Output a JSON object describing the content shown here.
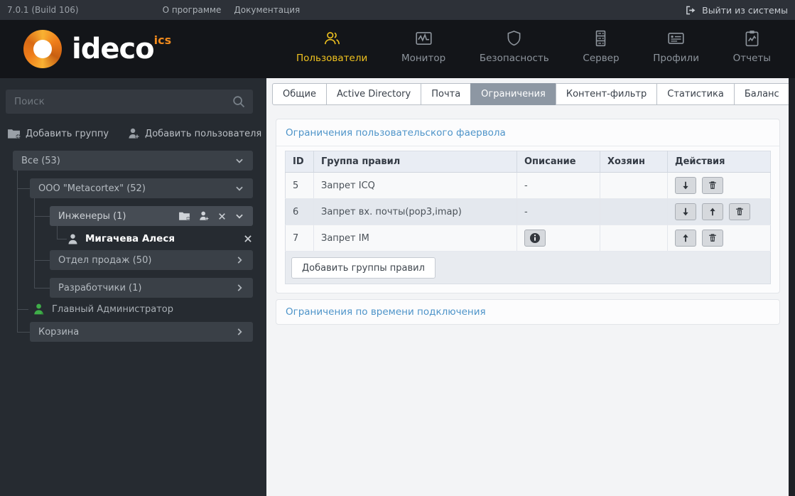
{
  "topbar": {
    "version": "7.0.1 (Build 106)",
    "about": "О программе",
    "docs": "Документация",
    "logout": "Выйти из системы"
  },
  "logo": {
    "brand": "ideco",
    "suffix": "ics"
  },
  "nav": {
    "items": [
      {
        "label": "Пользователи",
        "icon": "users-icon",
        "active": true
      },
      {
        "label": "Монитор",
        "icon": "monitor-icon",
        "active": false
      },
      {
        "label": "Безопасность",
        "icon": "shield-icon",
        "active": false
      },
      {
        "label": "Сервер",
        "icon": "server-icon",
        "active": false
      },
      {
        "label": "Профили",
        "icon": "id-card-icon",
        "active": false
      },
      {
        "label": "Отчеты",
        "icon": "report-icon",
        "active": false
      }
    ]
  },
  "sidebar": {
    "search_placeholder": "Поиск",
    "add_group": "Добавить группу",
    "add_user": "Добавить пользователя",
    "tree": [
      {
        "label": "Все (53)",
        "type": "group",
        "chevron": "down"
      },
      {
        "label": "ООО \"Metacortex\" (52)",
        "type": "group",
        "chevron": "down"
      },
      {
        "label": "Инженеры (1)",
        "type": "group",
        "chevron": "down",
        "selected": true,
        "actions": [
          "add-group",
          "add-user",
          "delete"
        ]
      },
      {
        "label": "Мигачева Алеся",
        "type": "user",
        "actions": [
          "delete"
        ]
      },
      {
        "label": "Отдел продаж (50)",
        "type": "group",
        "chevron": "right"
      },
      {
        "label": "Разработчики (1)",
        "type": "group",
        "chevron": "right"
      },
      {
        "label": "Главный Администратор",
        "type": "admin-user"
      },
      {
        "label": "Корзина",
        "type": "group",
        "chevron": "right"
      }
    ]
  },
  "main": {
    "tabs": [
      {
        "label": "Общие",
        "active": false
      },
      {
        "label": "Active Directory",
        "active": false
      },
      {
        "label": "Почта",
        "active": false
      },
      {
        "label": "Ограничения",
        "active": true
      },
      {
        "label": "Контент-фильтр",
        "active": false
      },
      {
        "label": "Статистика",
        "active": false
      },
      {
        "label": "Баланс",
        "active": false
      }
    ],
    "firewall_section": {
      "title": "Ограничения пользовательского фаервола",
      "table": {
        "headers": [
          "ID",
          "Группа правил",
          "Описание",
          "Хозяин",
          "Действия"
        ],
        "rows": [
          {
            "id": "5",
            "group": "Запрет ICQ",
            "description": "-",
            "owner": "",
            "actions": [
              "move-down",
              "delete"
            ]
          },
          {
            "id": "6",
            "group": "Запрет вх. почты(pop3,imap)",
            "description": "-",
            "owner": "",
            "actions": [
              "move-down",
              "move-up",
              "delete"
            ]
          },
          {
            "id": "7",
            "group": "Запрет IM",
            "description": "",
            "has_info": true,
            "owner": "",
            "actions": [
              "move-up",
              "delete"
            ]
          }
        ]
      },
      "add_button": "Добавить группы правил"
    },
    "time_section": {
      "title": "Ограничения по времени подключения"
    }
  },
  "colors": {
    "accent_yellow": "#f0c21f",
    "link_blue": "#4e94c9",
    "active_tab_bg": "#8d97a3",
    "topbar_bg": "#2d3138",
    "header_bg": "#131519",
    "sidebar_bg": "#262b31",
    "brand_orange": "#f08a1d"
  }
}
